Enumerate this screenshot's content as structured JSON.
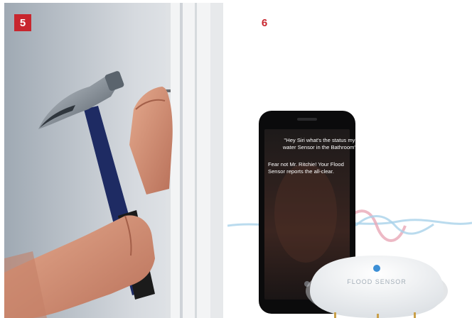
{
  "panels": [
    {
      "number": "5",
      "subject": "hand hammering a nail into a white door frame"
    },
    {
      "number": "6",
      "subject": "smartphone with Siri answering next to a flood sensor"
    }
  ],
  "siri": {
    "query": "\"Hey Siri what's the status my water Sensor in the Bathroom\"",
    "reply": "Fear not Mr. Ritchie! Your Flood Sensor reports the all-clear."
  },
  "sensor": {
    "label": "FLOOD SENSOR"
  },
  "colors": {
    "badge": "#c8262e",
    "hammer_handle": "#1e2b63",
    "hammer_grip": "#1b1b1b",
    "siri_wave_pink": "#e8a7b7",
    "siri_wave_blue": "#a9d2ea"
  }
}
